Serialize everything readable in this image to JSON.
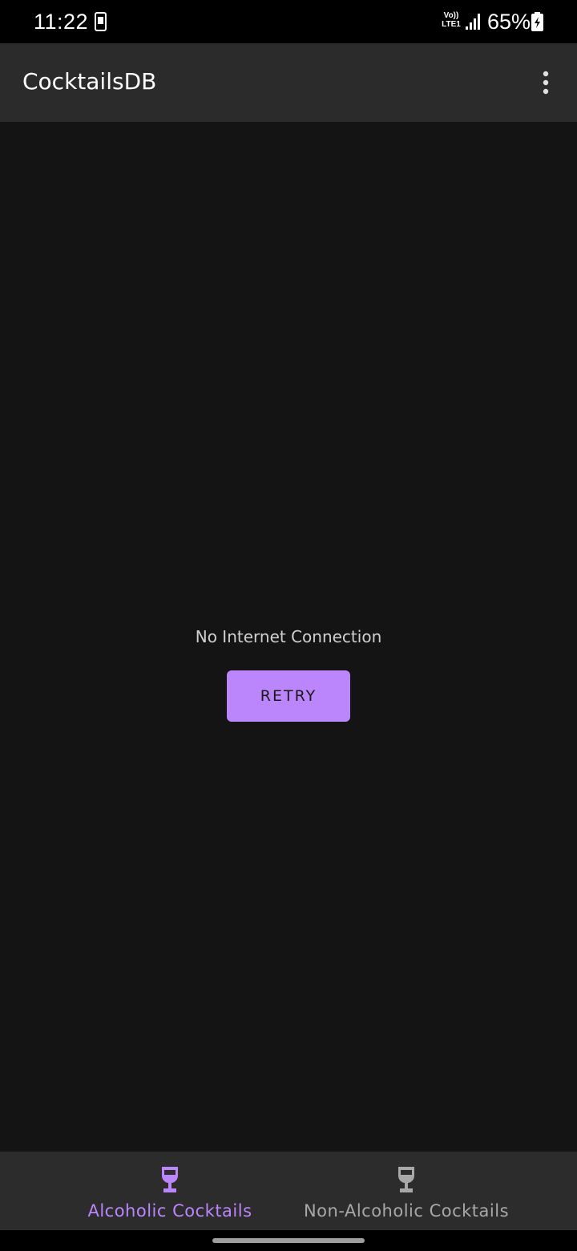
{
  "status_bar": {
    "time": "11:22",
    "network_label_line1": "Vo))",
    "network_label_line2": "LTE1",
    "battery_percent": "65%"
  },
  "app_bar": {
    "title": "CocktailsDB",
    "overflow_icon": "more-vert-icon"
  },
  "content": {
    "error_message": "No Internet Connection",
    "retry_label": "RETRY"
  },
  "bottom_nav": {
    "items": [
      {
        "label": "Alcoholic Cocktails",
        "icon": "wine-glass-icon",
        "selected": true
      },
      {
        "label": "Non-Alcoholic Cocktails",
        "icon": "wine-glass-icon",
        "selected": false
      }
    ]
  },
  "colors": {
    "accent": "#bb86fc",
    "background": "#121212",
    "app_bar": "#2b2b2b",
    "bottom_nav": "#2c2c2c",
    "inactive": "#a8a8a8"
  }
}
